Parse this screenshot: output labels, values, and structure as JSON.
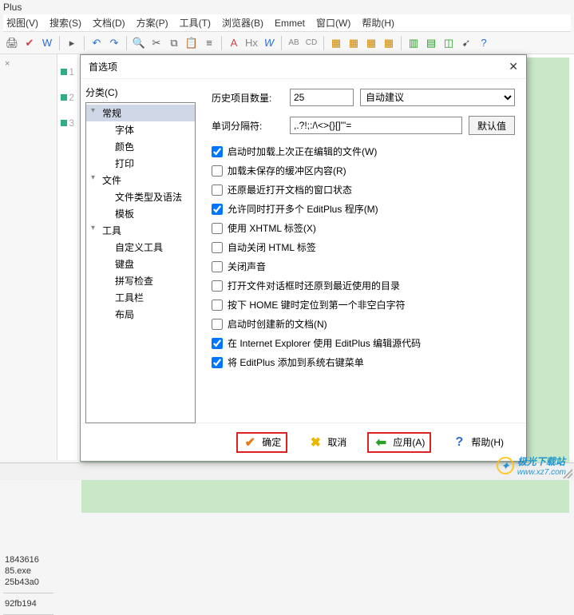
{
  "app_title": "Plus",
  "menubar": [
    "视图(V)",
    "搜索(S)",
    "文档(D)",
    "方案(P)",
    "工具(T)",
    "浏览器(B)",
    "Emmet",
    "窗口(W)",
    "帮助(H)"
  ],
  "toolbar_icons": [
    "print",
    "spellcheck",
    "word",
    "sep",
    "arrow",
    "sep",
    "undo",
    "redo",
    "sep",
    "search",
    "cut",
    "copy",
    "paste",
    "sep",
    "font-a",
    "font-x",
    "char-w",
    "sep",
    "ab",
    "cd",
    "sep",
    "form1",
    "form2",
    "form3",
    "form4",
    "sep",
    "doc1",
    "doc2",
    "doc3",
    "cursor",
    "help"
  ],
  "line_numbers": [
    "1",
    "2",
    "3"
  ],
  "files": [
    "1843616",
    "85.exe",
    "25b43a0",
    "",
    "92fb194"
  ],
  "dialog": {
    "title": "首选项",
    "category_label": "分类(C)",
    "tree": [
      {
        "label": "常规",
        "group": true,
        "selected": true
      },
      {
        "label": "字体",
        "sub": true
      },
      {
        "label": "颜色",
        "sub": true
      },
      {
        "label": "打印",
        "sub": true
      },
      {
        "label": "文件",
        "group": true
      },
      {
        "label": "文件类型及语法",
        "sub": true
      },
      {
        "label": "模板",
        "sub": true
      },
      {
        "label": "工具",
        "group": true
      },
      {
        "label": "自定义工具",
        "sub": true
      },
      {
        "label": "键盘",
        "sub": true
      },
      {
        "label": "拼写检查",
        "sub": true
      },
      {
        "label": "工具栏",
        "sub": true
      },
      {
        "label": "布局",
        "sub": true
      }
    ],
    "history_label": "历史项目数量:",
    "history_value": "25",
    "suggestion_options": [
      "自动建议"
    ],
    "delimiter_label": "单词分隔符:",
    "delimiter_value": ",.?!;:/\\<>{}[]\"'=",
    "default_btn": "默认值",
    "checkboxes": [
      {
        "label": "启动时加载上次正在编辑的文件(W)",
        "checked": true
      },
      {
        "label": "加载未保存的缓冲区内容(R)",
        "checked": false
      },
      {
        "label": "还原最近打开文档的窗口状态",
        "checked": false
      },
      {
        "label": "允许同时打开多个 EditPlus 程序(M)",
        "checked": true
      },
      {
        "label": "使用 XHTML 标签(X)",
        "checked": false
      },
      {
        "label": "自动关闭 HTML 标签",
        "checked": false
      },
      {
        "label": "关闭声音",
        "checked": false
      },
      {
        "label": "打开文件对话框时还原到最近使用的目录",
        "checked": false
      },
      {
        "label": "按下 HOME 键时定位到第一个非空白字符",
        "checked": false
      },
      {
        "label": "启动时创建新的文档(N)",
        "checked": false
      },
      {
        "label": "在 Internet Explorer 使用 EditPlus 编辑源代码",
        "checked": true
      },
      {
        "label": "将 EditPlus 添加到系统右键菜单",
        "checked": true
      }
    ],
    "buttons": {
      "ok": "确定",
      "cancel": "取消",
      "apply": "应用(A)",
      "help": "帮助(H)"
    }
  },
  "watermark": {
    "text": "极光下载站",
    "url": "www.xz7.com"
  }
}
